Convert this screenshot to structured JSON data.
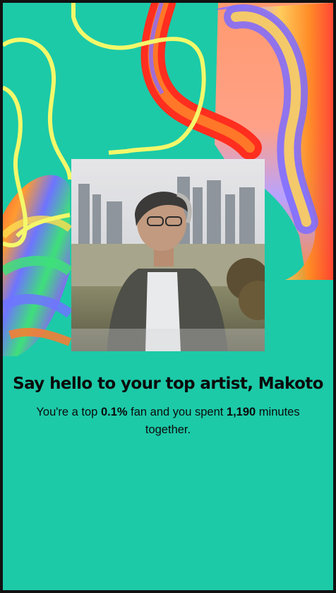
{
  "story": {
    "headline": "Say hello to your top artist, Makoto",
    "sub_prefix": "You're a top ",
    "percent": "0.1%",
    "sub_middle": " fan and you spent ",
    "minutes": "1,190",
    "sub_suffix": " minutes together."
  },
  "colors": {
    "background": "#1ccaa8",
    "text": "#0b0b0b",
    "squiggle": "#f4f86a"
  }
}
